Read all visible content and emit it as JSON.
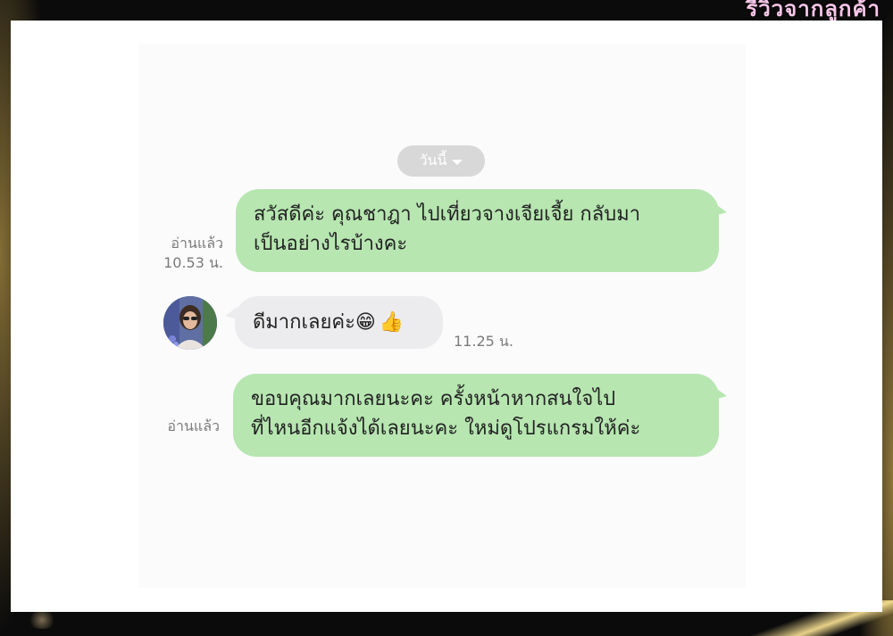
{
  "banner": {
    "title": "รีวิวจากลูกค้า"
  },
  "chat": {
    "date_chip": {
      "label": "วันนี้",
      "icon": "chevron-down-icon"
    },
    "messages": [
      {
        "direction": "outgoing",
        "lines": [
          "สวัสดีค่ะ  คุณชาฎา ไปเที่ยวจางเจียเจี้ย กลับมา",
          "เป็นอย่างไรบ้างคะ"
        ],
        "read_label": "อ่านแล้ว",
        "time": "10.53 น."
      },
      {
        "direction": "incoming",
        "text": "ดีมากเลยค่ะ",
        "emojis": [
          "😁",
          "👍"
        ],
        "time": "11.25 น.",
        "sender_avatar": "user-avatar"
      },
      {
        "direction": "outgoing",
        "lines": [
          "ขอบคุณมากเลยนะคะ ครั้งหน้าหากสนใจไป",
          "ที่ไหนอีกแจ้งได้เลยนะคะ ใหม่ดูโปรแกรมให้ค่ะ"
        ],
        "read_label": "อ่านแล้ว",
        "time": ""
      }
    ]
  },
  "colors": {
    "outgoing_bubble": "#b7e6b1",
    "incoming_bubble": "#ececee",
    "date_chip": "#d8d8d8",
    "meta_text": "#7b7b7b",
    "banner_text": "#f7c6e8"
  }
}
